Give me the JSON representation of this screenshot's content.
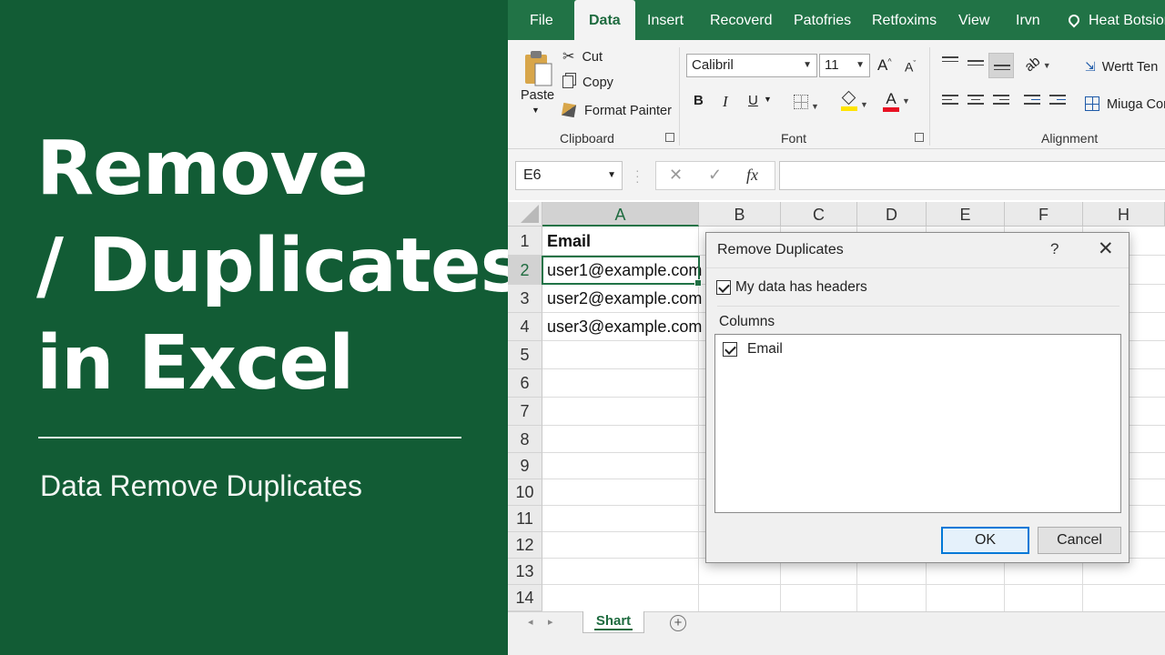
{
  "promo": {
    "title_lines": [
      "Remove",
      "/ Duplicates /",
      "in Excel"
    ],
    "subtitle": "Data Remove Duplicates",
    "background": "#125c35"
  },
  "ribbon_tabs": {
    "file": "File",
    "data": "Data",
    "insert": "Insert",
    "recoverd": "Recoverd",
    "patofries": "Patofries",
    "retfoxims": "Retfoxims",
    "view": "View",
    "irvn": "Irvn",
    "heat": "Heat Botsion",
    "accent": "#217346"
  },
  "clipboard": {
    "paste": "Paste",
    "cut": "Cut",
    "copy": "Copy",
    "format_painter": "Format Painter",
    "label": "Clipboard"
  },
  "font": {
    "name": "Calibril",
    "size": "11",
    "grow": "A",
    "shrink": "A",
    "bold": "B",
    "italic": "I",
    "underline": "U",
    "label": "Font"
  },
  "alignment": {
    "wrap_text": "Wertt Ten",
    "merge": "Miuga Comy",
    "label": "Alignment"
  },
  "formula_bar": {
    "name_box": "E6",
    "cancel": "✕",
    "enter": "✓",
    "fx": "fx",
    "value": ""
  },
  "grid": {
    "columns": [
      "A",
      "B",
      "C",
      "D",
      "E",
      "F",
      "H"
    ],
    "rows": [
      "1",
      "2",
      "3",
      "4",
      "5",
      "6",
      "7",
      "8",
      "9",
      "10",
      "11",
      "12",
      "13",
      "14"
    ],
    "cells": {
      "A1": "Email",
      "A2": "user1@example.com",
      "A3": "user2@example.com",
      "A4": "user3@example.com"
    }
  },
  "sheets": {
    "prev": "◂",
    "next": "▸",
    "active": "Shart",
    "add": "+"
  },
  "dialog": {
    "title": "Remove Duplicates",
    "help": "?",
    "close": "✕",
    "headers_option": "My data has headers",
    "headers_checked": true,
    "columns_label": "Columns",
    "columns": [
      {
        "label": "Email",
        "checked": true
      }
    ],
    "ok": "OK",
    "cancel": "Cancel"
  }
}
